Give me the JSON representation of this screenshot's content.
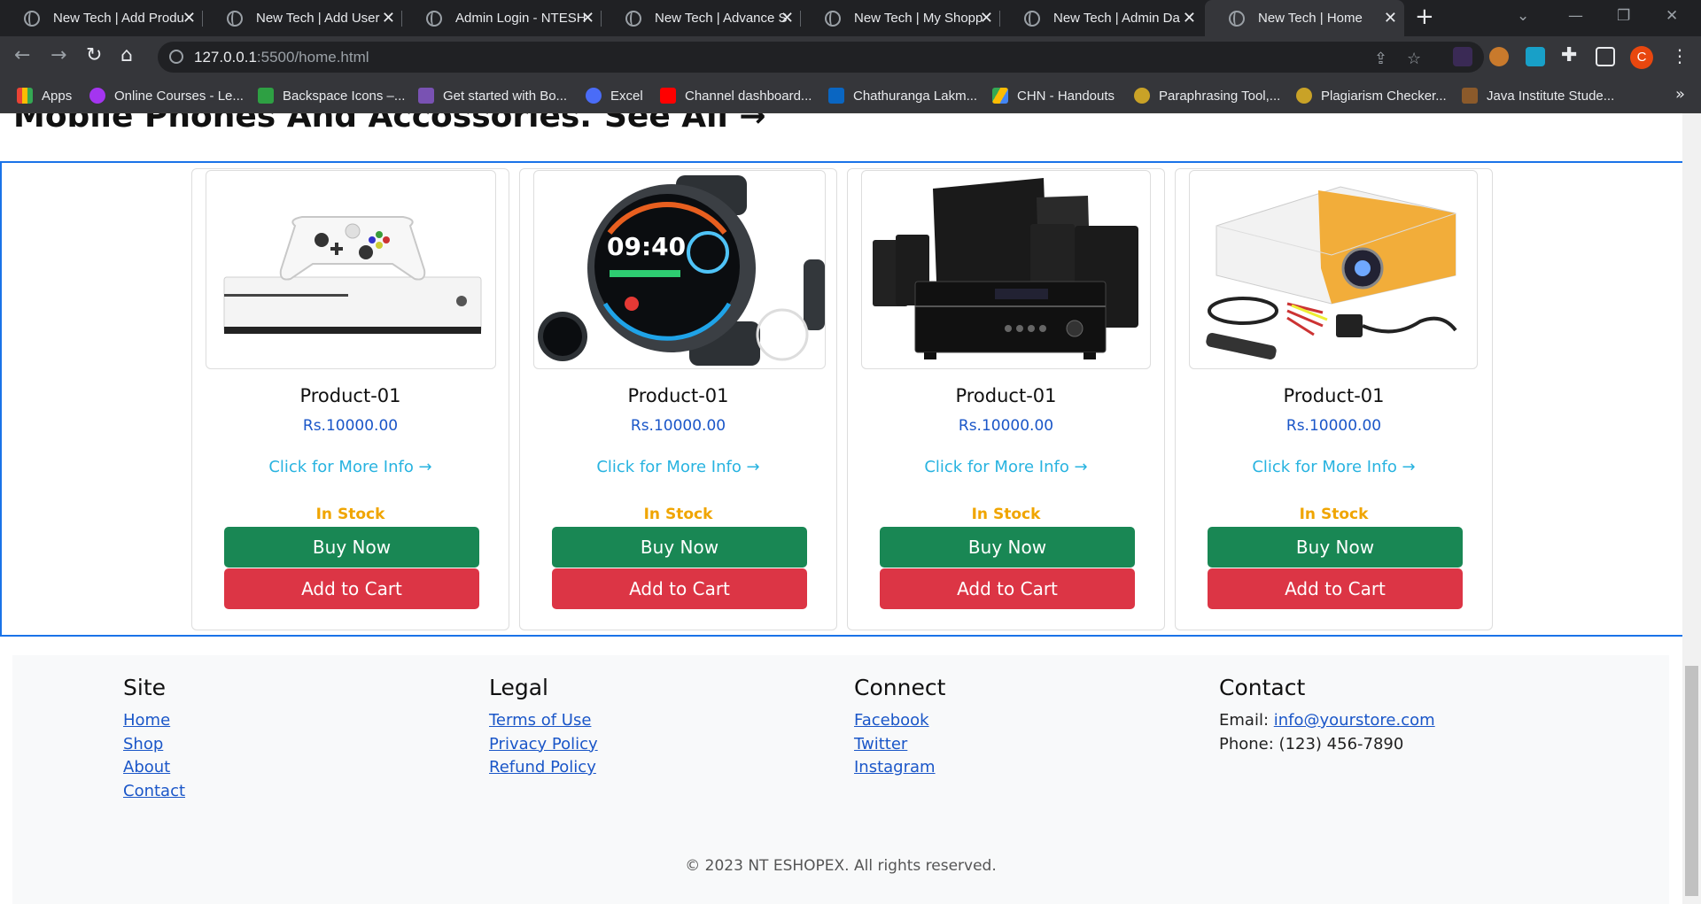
{
  "browser": {
    "tabs": [
      {
        "title": "New Tech | Add Produ",
        "active": false
      },
      {
        "title": "New Tech | Add User",
        "active": false
      },
      {
        "title": "Admin Login - NTESH",
        "active": false
      },
      {
        "title": "New Tech | Advance S",
        "active": false
      },
      {
        "title": "New Tech | My Shopp",
        "active": false
      },
      {
        "title": "New Tech | Admin Da",
        "active": false
      },
      {
        "title": "New Tech | Home",
        "active": true
      }
    ],
    "url_host": "127.0.0.1",
    "url_rest": ":5500/home.html",
    "profile_initial": "C",
    "bookmarks": [
      {
        "label": "Apps",
        "color": "#ea4335"
      },
      {
        "label": "Online Courses - Le...",
        "color": "#a435f0"
      },
      {
        "label": "Backspace Icons –...",
        "color": "#2ea043"
      },
      {
        "label": "Get started with Bo...",
        "color": "#7952b3"
      },
      {
        "label": "Excel",
        "color": "#4a6cf7"
      },
      {
        "label": "Channel dashboard...",
        "color": "#ff0000"
      },
      {
        "label": "Chathuranga Lakm...",
        "color": "#0a66c2"
      },
      {
        "label": "CHN - Handouts",
        "color": "#fbbc04"
      },
      {
        "label": "Paraphrasing Tool,...",
        "color": "#c9a227"
      },
      {
        "label": "Plagiarism Checker...",
        "color": "#c9a227"
      },
      {
        "label": "Java Institute Stude...",
        "color": "#8b5a2b"
      }
    ]
  },
  "section": {
    "heading": "Mobile Phones And Accossories.",
    "see_all": "See All →"
  },
  "products": [
    {
      "name": "Product-01",
      "price": "Rs.10000.00",
      "more_info": "Click for More Info →",
      "stock": "In Stock",
      "buy": "Buy Now",
      "cart": "Add to Cart",
      "image": "game-console-icon"
    },
    {
      "name": "Product-01",
      "price": "Rs.10000.00",
      "more_info": "Click for More Info →",
      "stock": "In Stock",
      "buy": "Buy Now",
      "cart": "Add to Cart",
      "image": "smartwatch-icon",
      "watch_time": "09:40"
    },
    {
      "name": "Product-01",
      "price": "Rs.10000.00",
      "more_info": "Click for More Info →",
      "stock": "In Stock",
      "buy": "Buy Now",
      "cart": "Add to Cart",
      "image": "home-theater-icon"
    },
    {
      "name": "Product-01",
      "price": "Rs.10000.00",
      "more_info": "Click for More Info →",
      "stock": "In Stock",
      "buy": "Buy Now",
      "cart": "Add to Cart",
      "image": "projector-icon"
    }
  ],
  "footer": {
    "site": {
      "title": "Site",
      "links": [
        "Home",
        "Shop",
        "About",
        "Contact"
      ]
    },
    "legal": {
      "title": "Legal",
      "links": [
        "Terms of Use",
        "Privacy Policy",
        "Refund Policy"
      ]
    },
    "connect": {
      "title": "Connect",
      "links": [
        "Facebook",
        "Twitter",
        "Instagram"
      ]
    },
    "contact": {
      "title": "Contact",
      "email_label": "Email:",
      "email": "info@yourstore.com",
      "phone": "Phone: (123) 456-7890"
    },
    "copyright": "© 2023 NT ESHOPEX. All rights reserved."
  },
  "colors": {
    "buy": "#198754",
    "cart": "#dc3545",
    "stock": "#f0a500",
    "price": "#1a56c8",
    "link": "#28b3e0"
  }
}
